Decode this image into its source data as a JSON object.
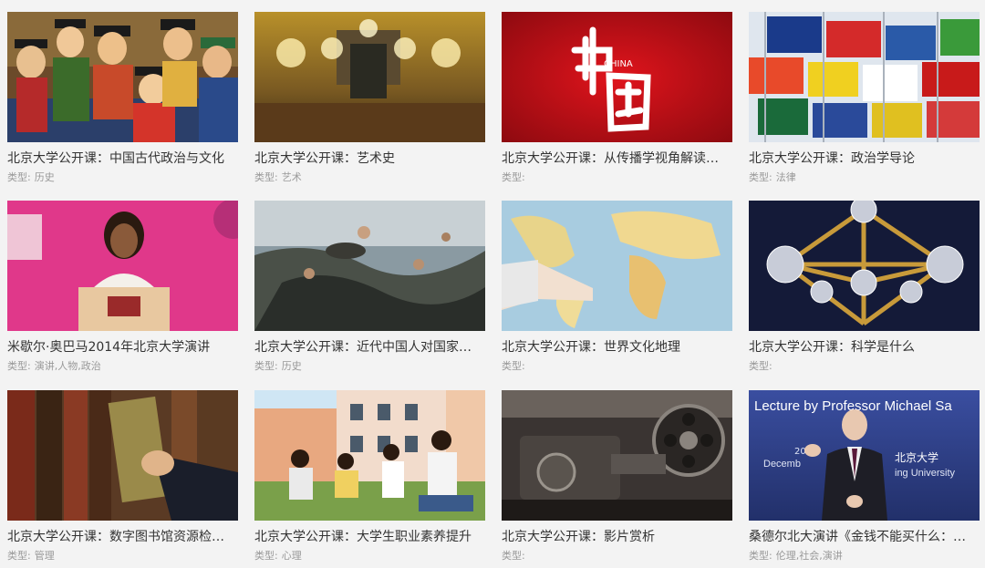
{
  "courses": [
    {
      "title": "北京大学公开课：中国古代政治与文化",
      "type_label": "类型:",
      "type_value": "历史",
      "thumb": "ancient-officials-painting"
    },
    {
      "title": "北京大学公开课：艺术史",
      "type_label": "类型:",
      "type_value": "艺术",
      "thumb": "opera-hall-chandeliers"
    },
    {
      "title": "北京大学公开课：从传播学视角解读…",
      "type_label": "类型:",
      "type_value": "",
      "thumb": "china-calligraphy-red",
      "thumb_text": "CHINA"
    },
    {
      "title": "北京大学公开课：政治学导论",
      "type_label": "类型:",
      "type_value": "法律",
      "thumb": "world-flags"
    },
    {
      "title": "米歇尔·奥巴马2014年北京大学演讲",
      "type_label": "类型:",
      "type_value": "演讲,人物,政治",
      "thumb": "speaker-pink-backdrop"
    },
    {
      "title": "北京大学公开课：近代中国人对国家…",
      "type_label": "类型:",
      "type_value": "历史",
      "thumb": "battle-painting"
    },
    {
      "title": "北京大学公开课：世界文化地理",
      "type_label": "类型:",
      "type_value": "",
      "thumb": "world-map-hand"
    },
    {
      "title": "北京大学公开课：科学是什么",
      "type_label": "类型:",
      "type_value": "",
      "thumb": "atomium-night"
    },
    {
      "title": "北京大学公开课：数字图书馆资源检…",
      "type_label": "类型:",
      "type_value": "管理",
      "thumb": "library-books"
    },
    {
      "title": "北京大学公开课：大学生职业素养提升",
      "type_label": "类型:",
      "type_value": "心理",
      "thumb": "students-on-grass"
    },
    {
      "title": "北京大学公开课：影片赏析",
      "type_label": "类型:",
      "type_value": "",
      "thumb": "film-projector"
    },
    {
      "title": "桑德尔北大演讲《金钱不能买什么：…",
      "type_label": "类型:",
      "type_value": "伦理,社会,演讲",
      "thumb": "lecture-stage",
      "thumb_text": "Lecture by Professor Michael Sa",
      "thumb_sub1": "北京大学",
      "thumb_sub2": "Decemb",
      "thumb_sub3": "ing University",
      "thumb_sub4": "201"
    }
  ]
}
